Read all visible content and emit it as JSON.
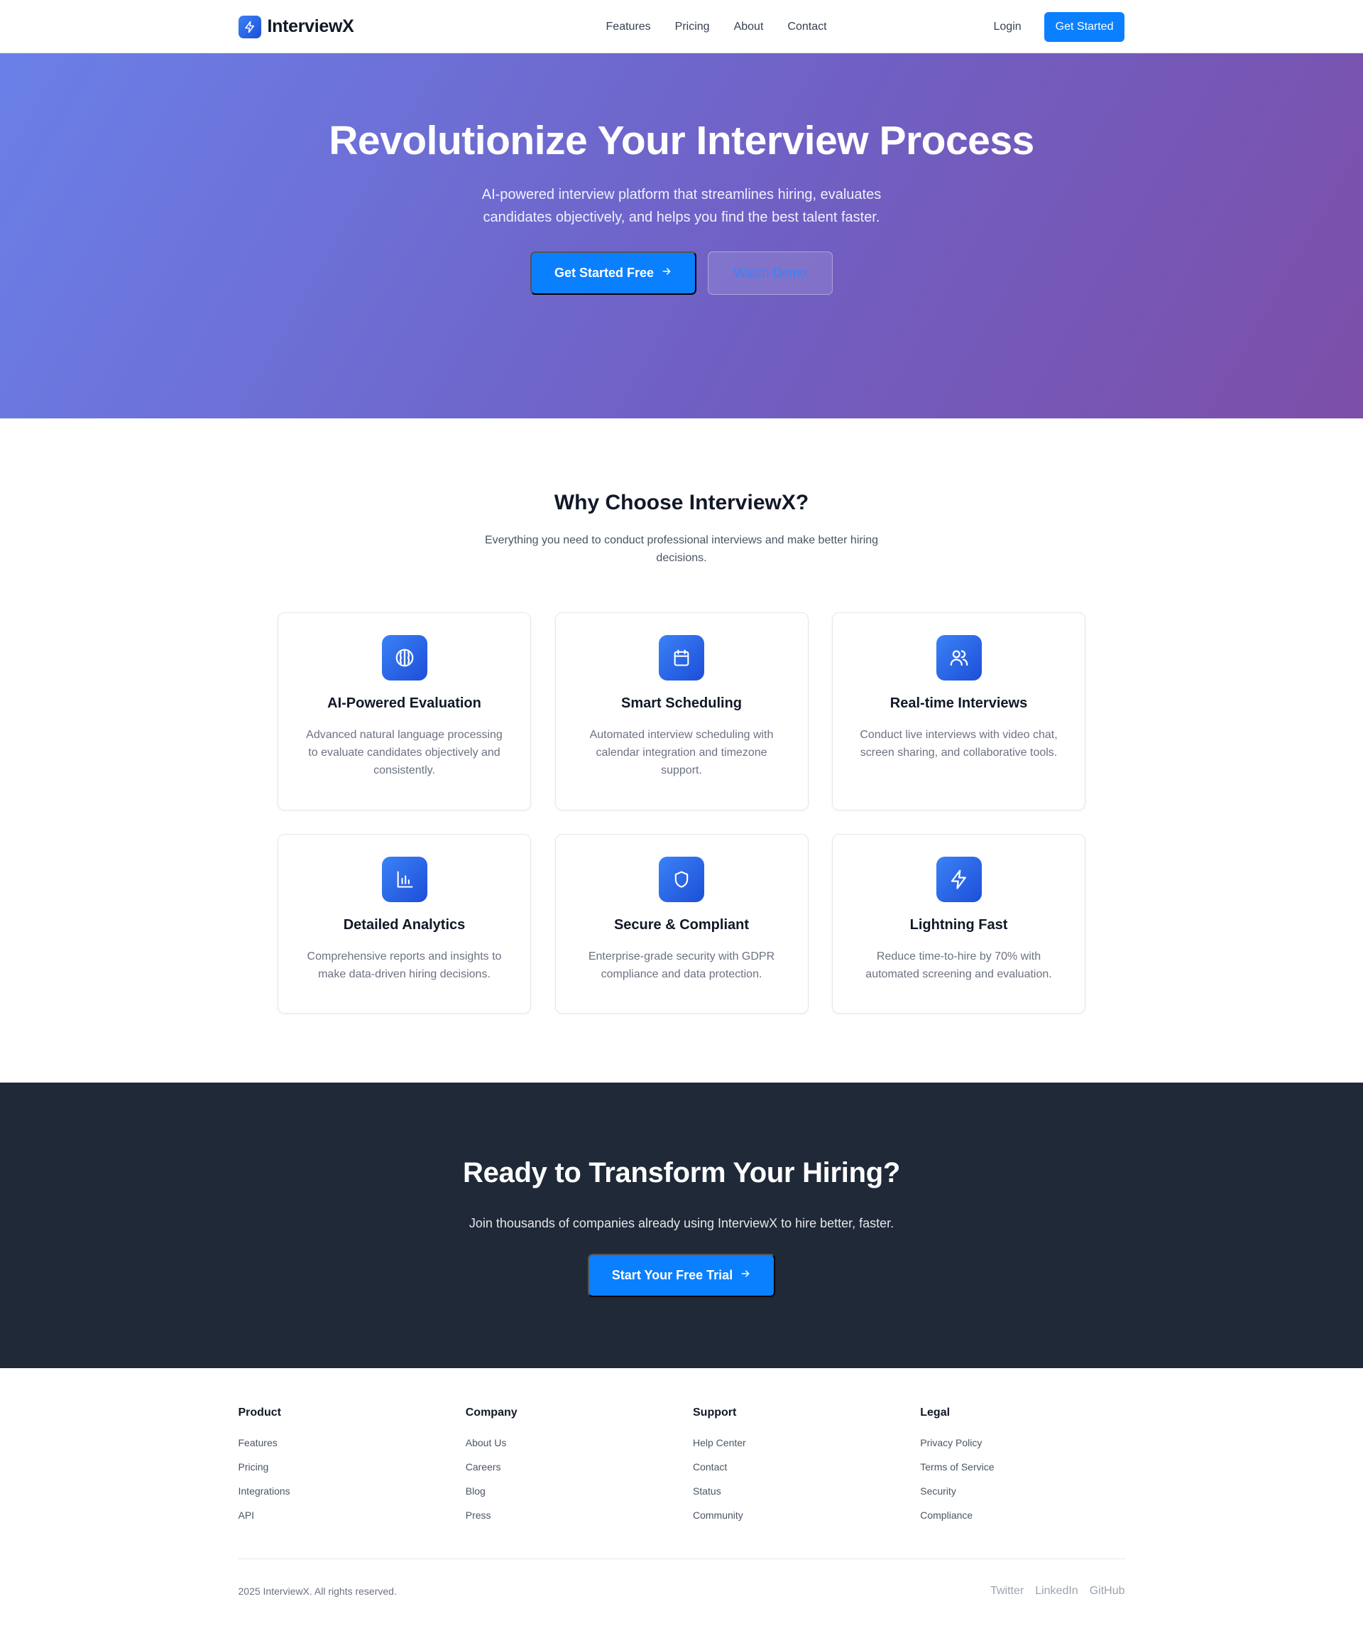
{
  "nav": {
    "brand": "InterviewX",
    "links": [
      "Features",
      "Pricing",
      "About",
      "Contact"
    ],
    "login": "Login",
    "cta": "Get Started"
  },
  "hero": {
    "title": "Revolutionize Your Interview Process",
    "subtitle": "AI-powered interview platform that streamlines hiring, evaluates candidates objectively, and helps you find the best talent faster.",
    "primary_button": "Get Started Free",
    "secondary_button": "Watch Demo"
  },
  "features": {
    "title": "Why Choose InterviewX?",
    "subtitle": "Everything you need to conduct professional interviews and make better hiring decisions.",
    "items": [
      {
        "icon": "brain-icon",
        "title": "AI-Powered Evaluation",
        "text": "Advanced natural language processing to evaluate candidates objectively and consistently."
      },
      {
        "icon": "calendar-icon",
        "title": "Smart Scheduling",
        "text": "Automated interview scheduling with calendar integration and timezone support."
      },
      {
        "icon": "users-icon",
        "title": "Real-time Interviews",
        "text": "Conduct live interviews with video chat, screen sharing, and collaborative tools."
      },
      {
        "icon": "bar-chart-icon",
        "title": "Detailed Analytics",
        "text": "Comprehensive reports and insights to make data-driven hiring decisions."
      },
      {
        "icon": "shield-icon",
        "title": "Secure & Compliant",
        "text": "Enterprise-grade security with GDPR compliance and data protection."
      },
      {
        "icon": "lightning-icon",
        "title": "Lightning Fast",
        "text": "Reduce time-to-hire by 70% with automated screening and evaluation."
      }
    ]
  },
  "cta": {
    "title": "Ready to Transform Your Hiring?",
    "subtitle": "Join thousands of companies already using InterviewX to hire better, faster.",
    "button": "Start Your Free Trial"
  },
  "footer": {
    "columns": [
      {
        "title": "Product",
        "links": [
          "Features",
          "Pricing",
          "Integrations",
          "API"
        ]
      },
      {
        "title": "Company",
        "links": [
          "About Us",
          "Careers",
          "Blog",
          "Press"
        ]
      },
      {
        "title": "Support",
        "links": [
          "Help Center",
          "Contact",
          "Status",
          "Community"
        ]
      },
      {
        "title": "Legal",
        "links": [
          "Privacy Policy",
          "Terms of Service",
          "Security",
          "Compliance"
        ]
      }
    ],
    "copyright": "2025 InterviewX. All rights reserved.",
    "socials": [
      "Twitter",
      "LinkedIn",
      "GitHub"
    ]
  },
  "colors": {
    "accent": "#0b80ff",
    "hero_start": "#6a80e8",
    "hero_end": "#7c4fa8",
    "dark": "#1f2937"
  }
}
